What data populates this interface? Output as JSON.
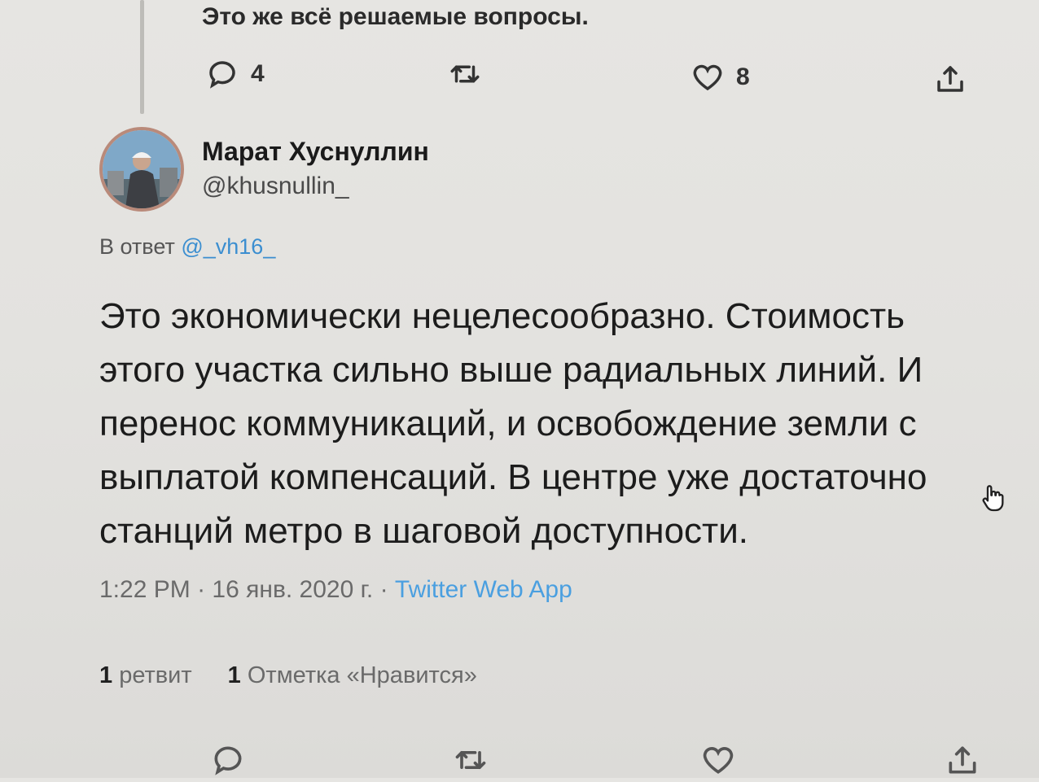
{
  "previous_tweet": {
    "text": "Это же всё решаемые вопросы.",
    "reply_count": "4",
    "like_count": "8"
  },
  "tweet": {
    "author_name": "Марат Хуснуллин",
    "author_handle": "@khusnullin_",
    "reply_label": "В ответ",
    "reply_mention": "@_vh16_",
    "lines": [
      "Это экономически нецелесообразно. Стоимость",
      "этого участка сильно выше радиальных линий. И",
      "перенос коммуникаций, и освобождение земли с",
      "выплатой компенсаций. В центре уже достаточно",
      "станций метро в шаговой доступности."
    ],
    "time": "1:22 PM",
    "date": "16 янв. 2020 г.",
    "separator": "·",
    "source": "Twitter Web App",
    "retweets_count": "1",
    "retweets_label": "ретвит",
    "likes_count": "1",
    "likes_label": "Отметка «Нравится»"
  },
  "icons": {
    "reply": "reply-icon",
    "retweet": "retweet-icon",
    "like": "heart-icon",
    "share": "share-icon",
    "cursor": "hand-cursor-icon"
  },
  "colors": {
    "link": "#3b8ed0",
    "source": "#4a9fe0",
    "avatar_ring": "#b98a7a"
  }
}
